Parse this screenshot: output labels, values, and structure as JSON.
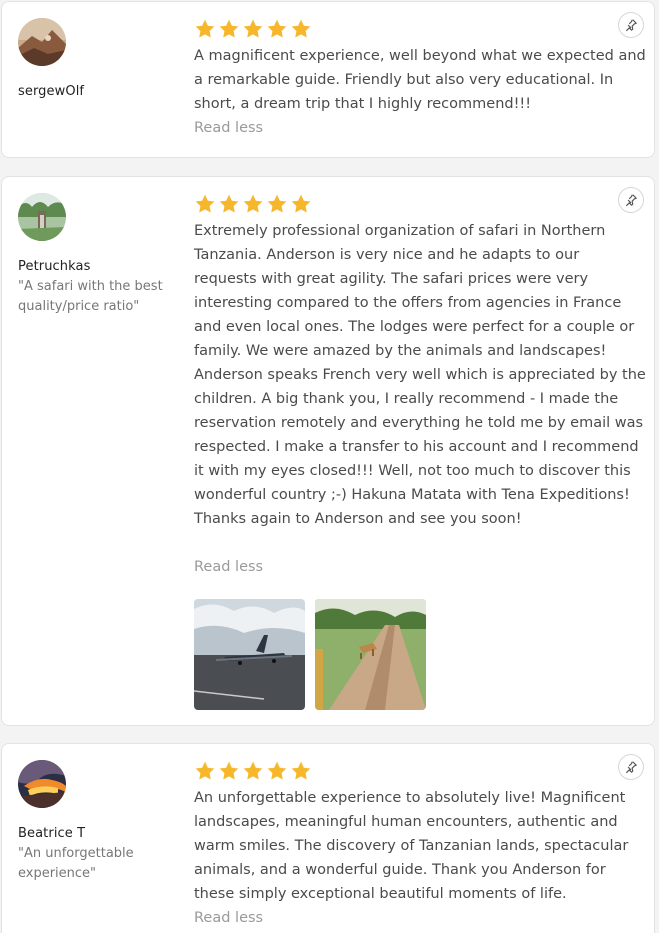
{
  "reviews": [
    {
      "author": "sergewOlf",
      "tagline": "",
      "rating": 5,
      "text": "A magnificent experience, well beyond what we expected and a remarkable guide. Friendly but also very educational. In short, a dream trip that I highly recommend!!!",
      "read_less": "Read less"
    },
    {
      "author": "Petruchkas",
      "tagline": "\"A safari with the best quality/price ratio\"",
      "rating": 5,
      "text": "Extremely professional organization of safari in Northern Tanzania. Anderson is very nice and he adapts to our requests with great agility. The safari prices were very interesting compared to the offers from agencies in France and even local ones. The lodges were perfect for a couple or family. We were amazed by the animals and landscapes! Anderson speaks French very well which is appreciated by the children. A big thank you, I really recommend - I made the reservation remotely and everything he told me by email was respected. I make a transfer to his account and I recommend it with my eyes closed!!! Well, not too much to discover this wonderful country ;-) Hakuna Matata with Tena Expeditions! Thanks again to Anderson and see you soon!",
      "read_less": "Read less"
    },
    {
      "author": "Beatrice T",
      "tagline": "\"An unforgettable experience\"",
      "rating": 5,
      "text": "An unforgettable experience to absolutely live! Magnificent landscapes, meaningful human encounters, authentic and warm smiles. The discovery of Tanzanian lands, spectacular animals, and a wonderful guide. Thank you Anderson for these simply exceptional beautiful moments of life.",
      "read_less": "Read less"
    }
  ],
  "colors": {
    "star": "#f7b72a",
    "link": "#9a9a9a"
  },
  "icons": {
    "pin": "pin-icon",
    "star": "star-icon"
  }
}
